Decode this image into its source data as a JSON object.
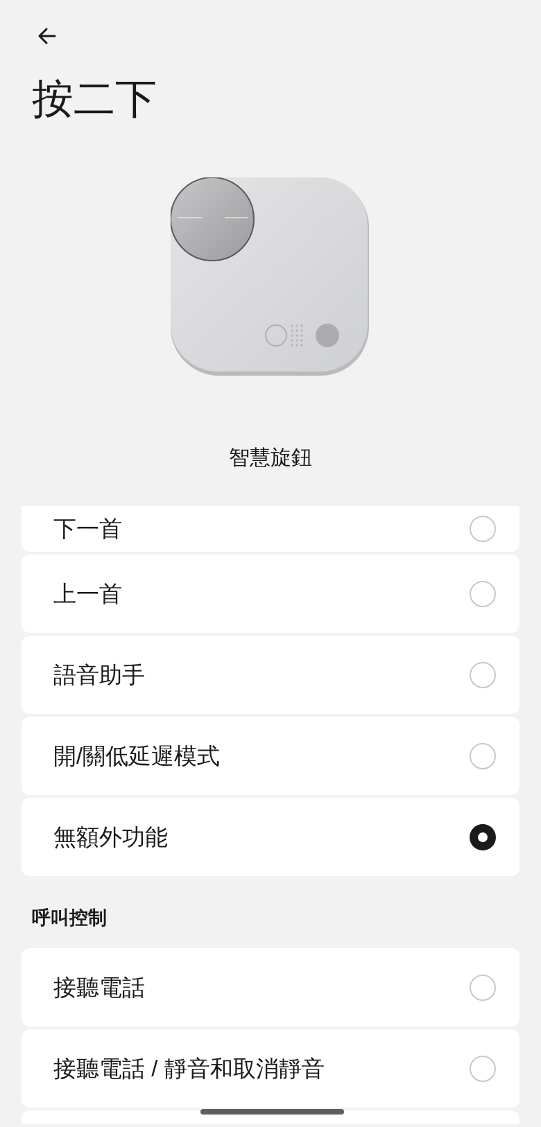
{
  "header": {
    "title": "按二下"
  },
  "device": {
    "caption": "智慧旋鈕"
  },
  "sections": [
    {
      "options": [
        {
          "label": "下一首",
          "selected": false
        },
        {
          "label": "上一首",
          "selected": false
        },
        {
          "label": "語音助手",
          "selected": false
        },
        {
          "label": "開/關低延遲模式",
          "selected": false
        },
        {
          "label": "無額外功能",
          "selected": true
        }
      ]
    },
    {
      "heading": "呼叫控制",
      "options": [
        {
          "label": "接聽電話",
          "selected": false
        },
        {
          "label": "接聽電話 / 靜音和取消靜音",
          "selected": false
        }
      ]
    }
  ]
}
